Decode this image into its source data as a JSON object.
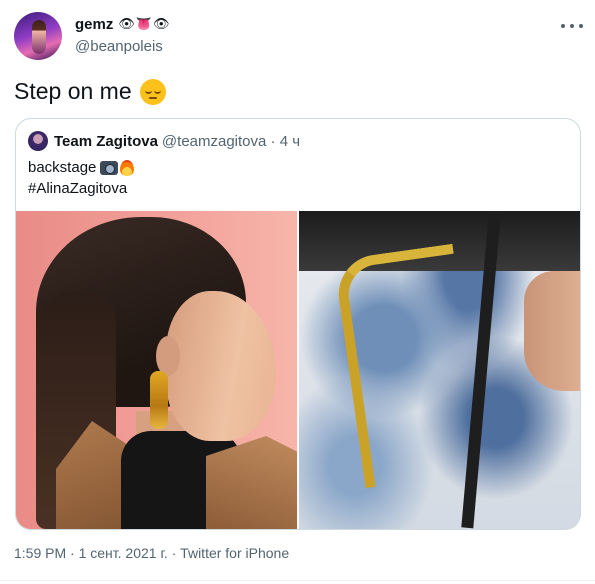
{
  "tweet": {
    "author": {
      "display_name": "gemz",
      "name_emoji": "👁👅👁",
      "handle": "@beanpoleis"
    },
    "text": "Step on me",
    "text_emoji": "pensive-face-icon",
    "meta": "1:59 PM · 1 сент. 2021 г. · Twitter for iPhone"
  },
  "quoted": {
    "display_name": "Team Zagitova",
    "handle_time": "@teamzagitova · 4 ч",
    "line1": "backstage",
    "line1_icons": [
      "camera-icon",
      "fire-icon"
    ],
    "line2": "#AlinaZagitova",
    "images": [
      "photo-left-portrait",
      "photo-right-shirt-chain"
    ]
  },
  "colors": {
    "text": "#0f1419",
    "secondary": "#536471",
    "border": "#cfd9de"
  }
}
